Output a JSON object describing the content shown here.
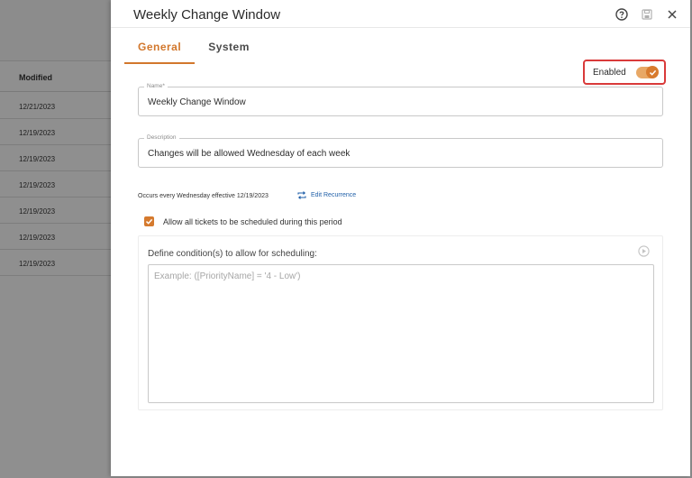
{
  "background_list": {
    "column_header": "Modified",
    "rows": [
      "12/21/2023",
      "12/19/2023",
      "12/19/2023",
      "12/19/2023",
      "12/19/2023",
      "12/19/2023",
      "12/19/2023"
    ]
  },
  "panel": {
    "title": "Weekly Change Window",
    "header_icons": [
      "help-icon",
      "save-icon",
      "close-icon"
    ],
    "tabs": [
      {
        "label": "General",
        "active": true
      },
      {
        "label": "System",
        "active": false
      }
    ],
    "enabled": {
      "label": "Enabled",
      "value": true
    },
    "name_field": {
      "label": "Name*",
      "value": "Weekly Change Window"
    },
    "description_field": {
      "label": "Description",
      "value": "Changes will be allowed Wednesday of each week"
    },
    "recurrence": {
      "text": "Occurs every Wednesday effective 12/19/2023",
      "edit_label": "Edit Recurrence"
    },
    "allow_all": {
      "label": "Allow all tickets to be scheduled during this period",
      "checked": true
    },
    "conditions": {
      "label": "Define condition(s) to allow for scheduling:",
      "placeholder": "Example: ([PriorityName] = '4 - Low')",
      "value": ""
    }
  },
  "colors": {
    "accent": "#d2772c",
    "highlight_border": "#d93a3a",
    "link": "#1f5fa8"
  }
}
